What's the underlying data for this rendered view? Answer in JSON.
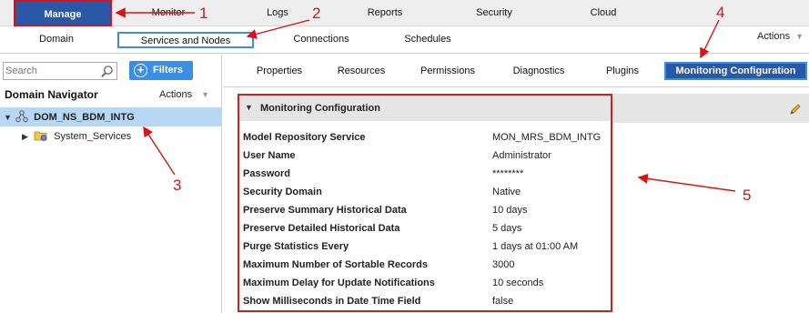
{
  "top_nav": {
    "tabs": [
      {
        "label": "Manage",
        "active": true
      },
      {
        "label": "Monitor",
        "active": false
      },
      {
        "label": "Logs",
        "active": false
      },
      {
        "label": "Reports",
        "active": false
      },
      {
        "label": "Security",
        "active": false
      },
      {
        "label": "Cloud",
        "active": false
      }
    ]
  },
  "sub_nav": {
    "tabs": [
      {
        "label": "Domain",
        "active": false
      },
      {
        "label": "Services and Nodes",
        "active": true
      },
      {
        "label": "Connections",
        "active": false
      },
      {
        "label": "Schedules",
        "active": false
      }
    ],
    "actions_label": "Actions"
  },
  "left_panel": {
    "search_placeholder": "Search",
    "filters_label": "Filters",
    "title": "Domain Navigator",
    "actions_label": "Actions",
    "tree": {
      "domain": "DOM_NS_BDM_INTG",
      "child": "System_Services"
    }
  },
  "right_panel": {
    "tabs": [
      {
        "label": "Properties",
        "active": false
      },
      {
        "label": "Resources",
        "active": false
      },
      {
        "label": "Permissions",
        "active": false
      },
      {
        "label": "Diagnostics",
        "active": false
      },
      {
        "label": "Plugins",
        "active": false
      },
      {
        "label": "Monitoring Configuration",
        "active": true
      }
    ],
    "section_title": "Monitoring Configuration",
    "properties": [
      {
        "key": "Model Repository Service",
        "value": "MON_MRS_BDM_INTG"
      },
      {
        "key": "User Name",
        "value": "Administrator"
      },
      {
        "key": "Password",
        "value": "********"
      },
      {
        "key": "Security Domain",
        "value": "Native"
      },
      {
        "key": "Preserve Summary Historical Data",
        "value": "10 days"
      },
      {
        "key": "Preserve Detailed Historical Data",
        "value": "5 days"
      },
      {
        "key": "Purge Statistics Every",
        "value": "1 days at 01:00 AM"
      },
      {
        "key": "Maximum Number of Sortable Records",
        "value": "3000"
      },
      {
        "key": "Maximum Delay for Update Notifications",
        "value": "10 seconds"
      },
      {
        "key": "Show Milliseconds in Date Time Field",
        "value": "false"
      }
    ]
  },
  "annotations": {
    "markers": [
      "1",
      "2",
      "3",
      "4",
      "5"
    ],
    "color": "#dd1111"
  },
  "colors": {
    "active_tab": "#2b58a6",
    "selection": "#b8d7f4",
    "filters_button": "#3a8ee6"
  }
}
